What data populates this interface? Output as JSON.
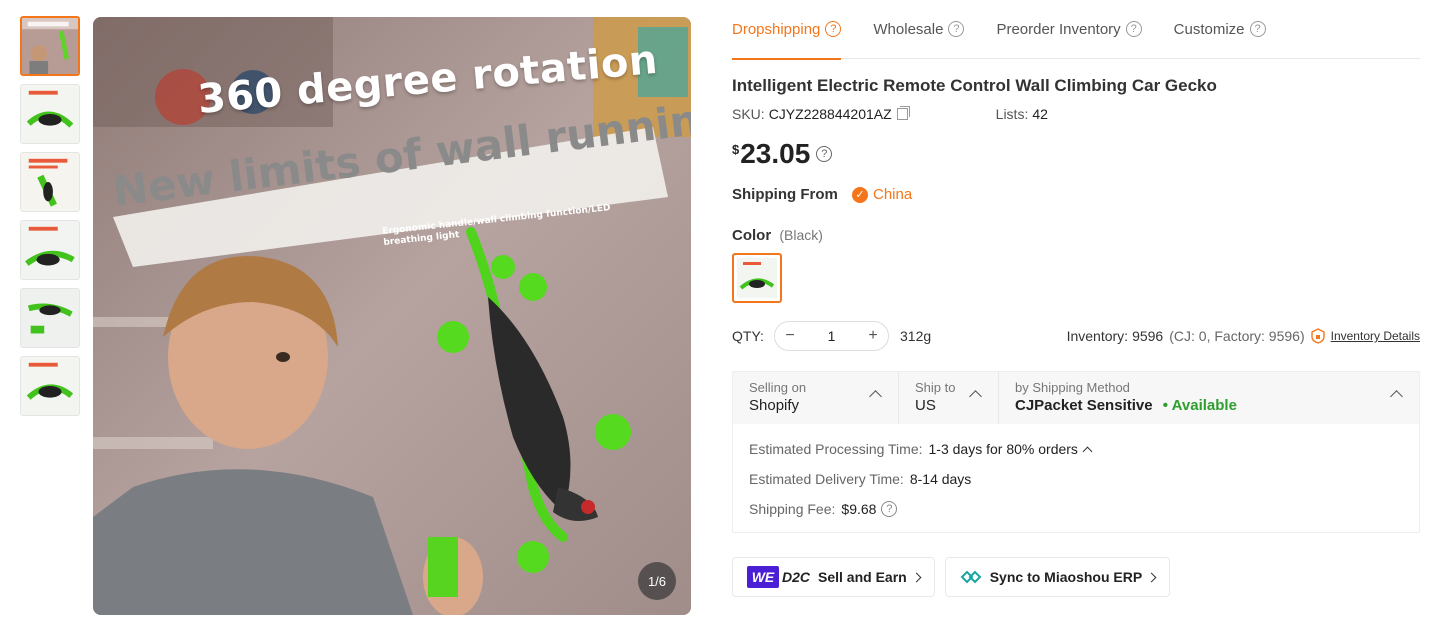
{
  "gallery": {
    "counter": "1/6",
    "headline1": "360 degree rotation",
    "headline2": "New limits of wall running",
    "subline": "Ergonomic handle/wall climbing function/LED breathing light"
  },
  "tabs": [
    {
      "label": "Dropshipping",
      "active": true
    },
    {
      "label": "Wholesale",
      "active": false
    },
    {
      "label": "Preorder Inventory",
      "active": false
    },
    {
      "label": "Customize",
      "active": false
    }
  ],
  "product": {
    "title": "Intelligent Electric Remote Control Wall Climbing Car Gecko",
    "sku_label": "SKU:",
    "sku": "CJYZ228844201AZ",
    "lists_label": "Lists:",
    "lists": "42",
    "currency": "$",
    "price": "23.05"
  },
  "shipping_from": {
    "label": "Shipping From",
    "country": "China"
  },
  "color": {
    "label": "Color",
    "selected": "(Black)"
  },
  "qty": {
    "label": "QTY:",
    "minus": "−",
    "value": "1",
    "plus": "+",
    "weight": "312g",
    "inventory_label": "Inventory:",
    "inventory": "9596",
    "inventory_detail": "(CJ: 0, Factory: 9596)",
    "inventory_link": "Inventory Details"
  },
  "shipping": {
    "selling_on_label": "Selling on",
    "selling_on": "Shopify",
    "ship_to_label": "Ship to",
    "ship_to": "US",
    "method_label": "by Shipping Method",
    "method": "CJPacket Sensitive",
    "availability": "• Available",
    "processing_label": "Estimated Processing Time:",
    "processing": "1-3 days for 80% orders",
    "delivery_label": "Estimated Delivery Time:",
    "delivery": "8-14 days",
    "fee_label": "Shipping Fee:",
    "fee": "$9.68"
  },
  "actions": {
    "we_badge": "WE",
    "d2c": "D2C",
    "sell_earn": "Sell and Earn",
    "sync": "Sync to Miaoshou ERP"
  },
  "colors": {
    "accent": "#f5761a",
    "available": "#2e9e2e",
    "we_purple": "#4b1fd6"
  }
}
